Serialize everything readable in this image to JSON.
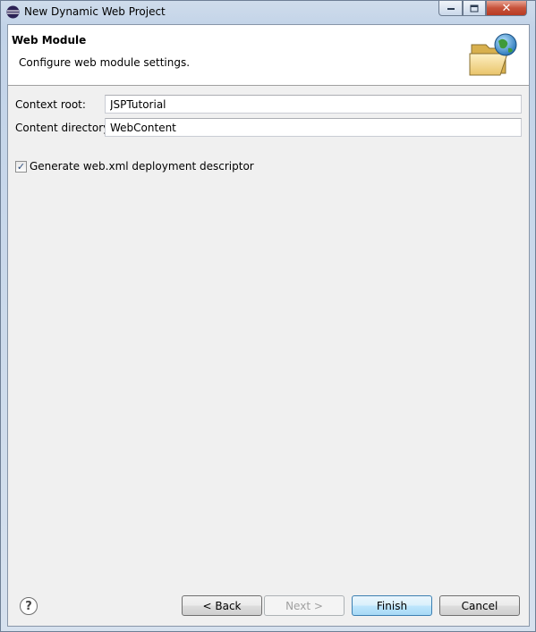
{
  "window": {
    "title": "New Dynamic Web Project",
    "controls": {
      "minimize": "minimize-icon",
      "maximize": "maximize-icon",
      "close": "close-icon"
    }
  },
  "banner": {
    "title": "Web Module",
    "description": "Configure web module settings.",
    "icon": "folder-globe-icon"
  },
  "form": {
    "context_root": {
      "label": "Context root:",
      "value": "JSPTutorial"
    },
    "content_directory": {
      "label": "Content directory:",
      "value": "WebContent"
    },
    "generate_descriptor": {
      "label": "Generate web.xml deployment descriptor",
      "checked": true
    }
  },
  "buttons": {
    "help": "?",
    "back": "< Back",
    "next": "Next >",
    "finish": "Finish",
    "cancel": "Cancel"
  },
  "colors": {
    "accent": "#3c7fb1",
    "close": "#c7523a"
  }
}
